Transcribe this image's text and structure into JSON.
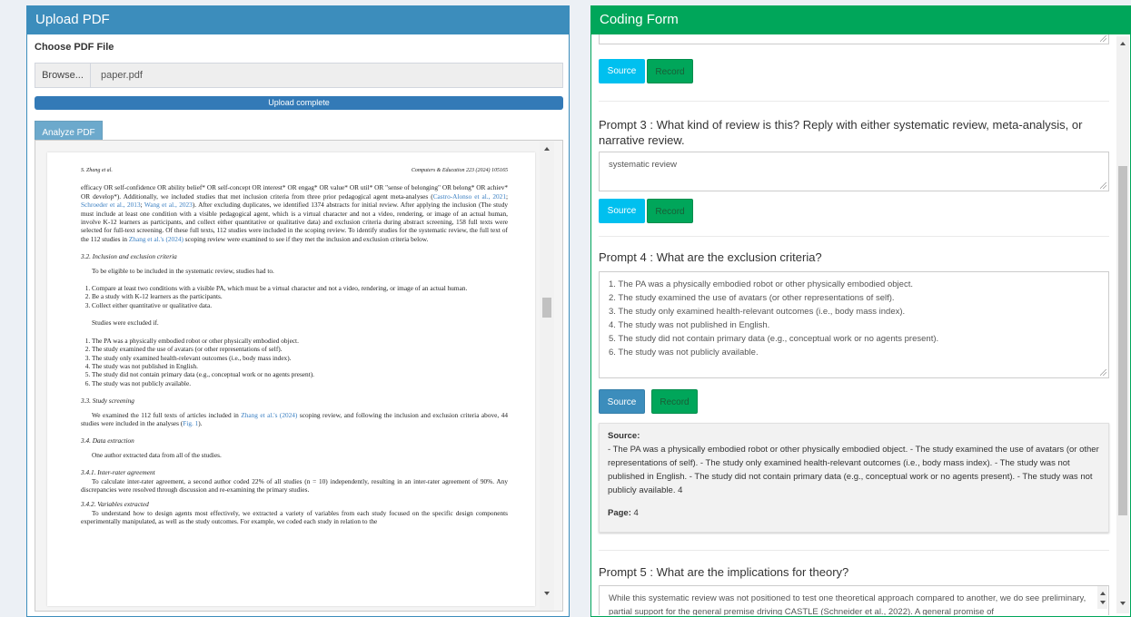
{
  "left_panel": {
    "title": "Upload PDF",
    "choose_label": "Choose PDF File",
    "browse_label": "Browse...",
    "file_name": "paper.pdf",
    "progress_text": "Upload complete",
    "progress_pct": 100,
    "analyze_label": "Analyze PDF"
  },
  "pdf": {
    "header_left": "S. Zhang et al.",
    "header_right": "Computers & Education 223 (2024) 105165",
    "para1_a": "efficacy OR self-confidence OR ability belief* OR self-concept OR interest* OR engag* OR value* OR util* OR \"sense of belonging\" OR belong* OR achiev* OR develop*). Additionally, we included studies that met inclusion criteria from three prior pedagogical agent meta-analyses (",
    "cite1": "Castro-Alonso et al., 2021",
    "sep1": "; ",
    "cite2": "Schroeder et al., 2013",
    "sep2": "; ",
    "cite3": "Wang et al., 2023",
    "para1_b": "). After excluding duplicates, we identified 1374 abstracts for initial review. After applying the inclusion (The study must include at least one condition with a visible pedagogical agent, which is a virtual character and not a video, rendering, or image of an actual human, involve K-12 learners as participants, and collect either quantitative or qualitative data) and exclusion criteria during abstract screening, 158 full texts were selected for full-text screening. Of these full texts, 112 studies were included in the scoping review. To identify studies for the systematic review, the full text of the 112 studies in ",
    "cite4": "Zhang et al.'s (2024)",
    "para1_c": " scoping review were examined to see if they met the inclusion and exclusion criteria below.",
    "sec_32": "3.2.  Inclusion and exclusion criteria",
    "para2": "To be eligible to be included in the systematic review, studies had to.",
    "incl": [
      "Compare at least two conditions with a visible PA, which must be a virtual character and not a video, rendering, or image of an actual human.",
      "Be a study with K-12 learners as the participants.",
      "Collect either quantitative or qualitative data."
    ],
    "para3": "Studies were excluded if.",
    "excl": [
      "The PA was a physically embodied robot or other physically embodied object.",
      "The study examined the use of avatars (or other representations of self).",
      "The study only examined health-relevant outcomes (i.e., body mass index).",
      "The study was not published in English.",
      "The study did not contain primary data (e.g., conceptual work or no agents present).",
      "The study was not publicly available."
    ],
    "sec_33": "3.3.  Study screening",
    "para4_a": "We examined the 112 full texts of articles included in ",
    "cite5": "Zhang et al.'s (2024)",
    "para4_b": " scoping review, and following the inclusion and exclusion criteria above, 44 studies were included in the analyses (",
    "cite6": "Fig. 1",
    "para4_c": ").",
    "sec_34": "3.4.  Data extraction",
    "para5": "One author extracted data from all of the studies.",
    "sec_341": "3.4.1.  Inter-rater agreement",
    "para6": "To calculate inter-rater agreement, a second author coded 22% of all studies (n = 10) independently, resulting in an inter-rater agreement of 90%. Any discrepancies were resolved through discussion and re-examining the primary studies.",
    "sec_342": "3.4.2.  Variables extracted",
    "para7": "To understand how to design agents most effectively, we extracted a variety of variables from each study focused on the specific design components experimentally manipulated, as well as the study outcomes. For example, we coded each study in relation to the"
  },
  "right_panel": {
    "title": "Coding Form",
    "source_label": "Source",
    "record_label": "Record",
    "prompt3": "Prompt 3 : What kind of review is this? Reply with either systematic review, meta-analysis, or narrative review.",
    "answer3": "systematic review",
    "prompt4": "Prompt 4 : What are the exclusion criteria?",
    "answer4_lines": [
      "1. The PA was a physically embodied robot or other physically embodied object.",
      "2. The study examined the use of avatars (or other representations of self).",
      "3. The study only examined health-relevant outcomes (i.e., body mass index).",
      "4. The study was not published in English.",
      "5. The study did not contain primary data (e.g., conceptual work or no agents present).",
      "6. The study was not publicly available."
    ],
    "source_heading": "Source:",
    "source_text": "- The PA was a physically embodied robot or other physically embodied object. - The study examined the use of avatars (or other representations of self). - The study only examined health-relevant outcomes (i.e., body mass index). - The study was not published in English. - The study did not contain primary data (e.g., conceptual work or no agents present). - The study was not publicly available. 4",
    "page_label": "Page:",
    "page_value": "4",
    "prompt5": "Prompt 5 : What are the implications for theory?",
    "answer5": "While this systematic review was not positioned to test one theoretical approach compared to another, we do see preliminary, partial support for the general premise driving CASTLE (Schneider et al., 2022). A general promise of"
  },
  "colors": {
    "primary": "#3c8dbc",
    "success": "#00a65a",
    "info": "#00c0ef",
    "link": "#3a7fc2"
  }
}
